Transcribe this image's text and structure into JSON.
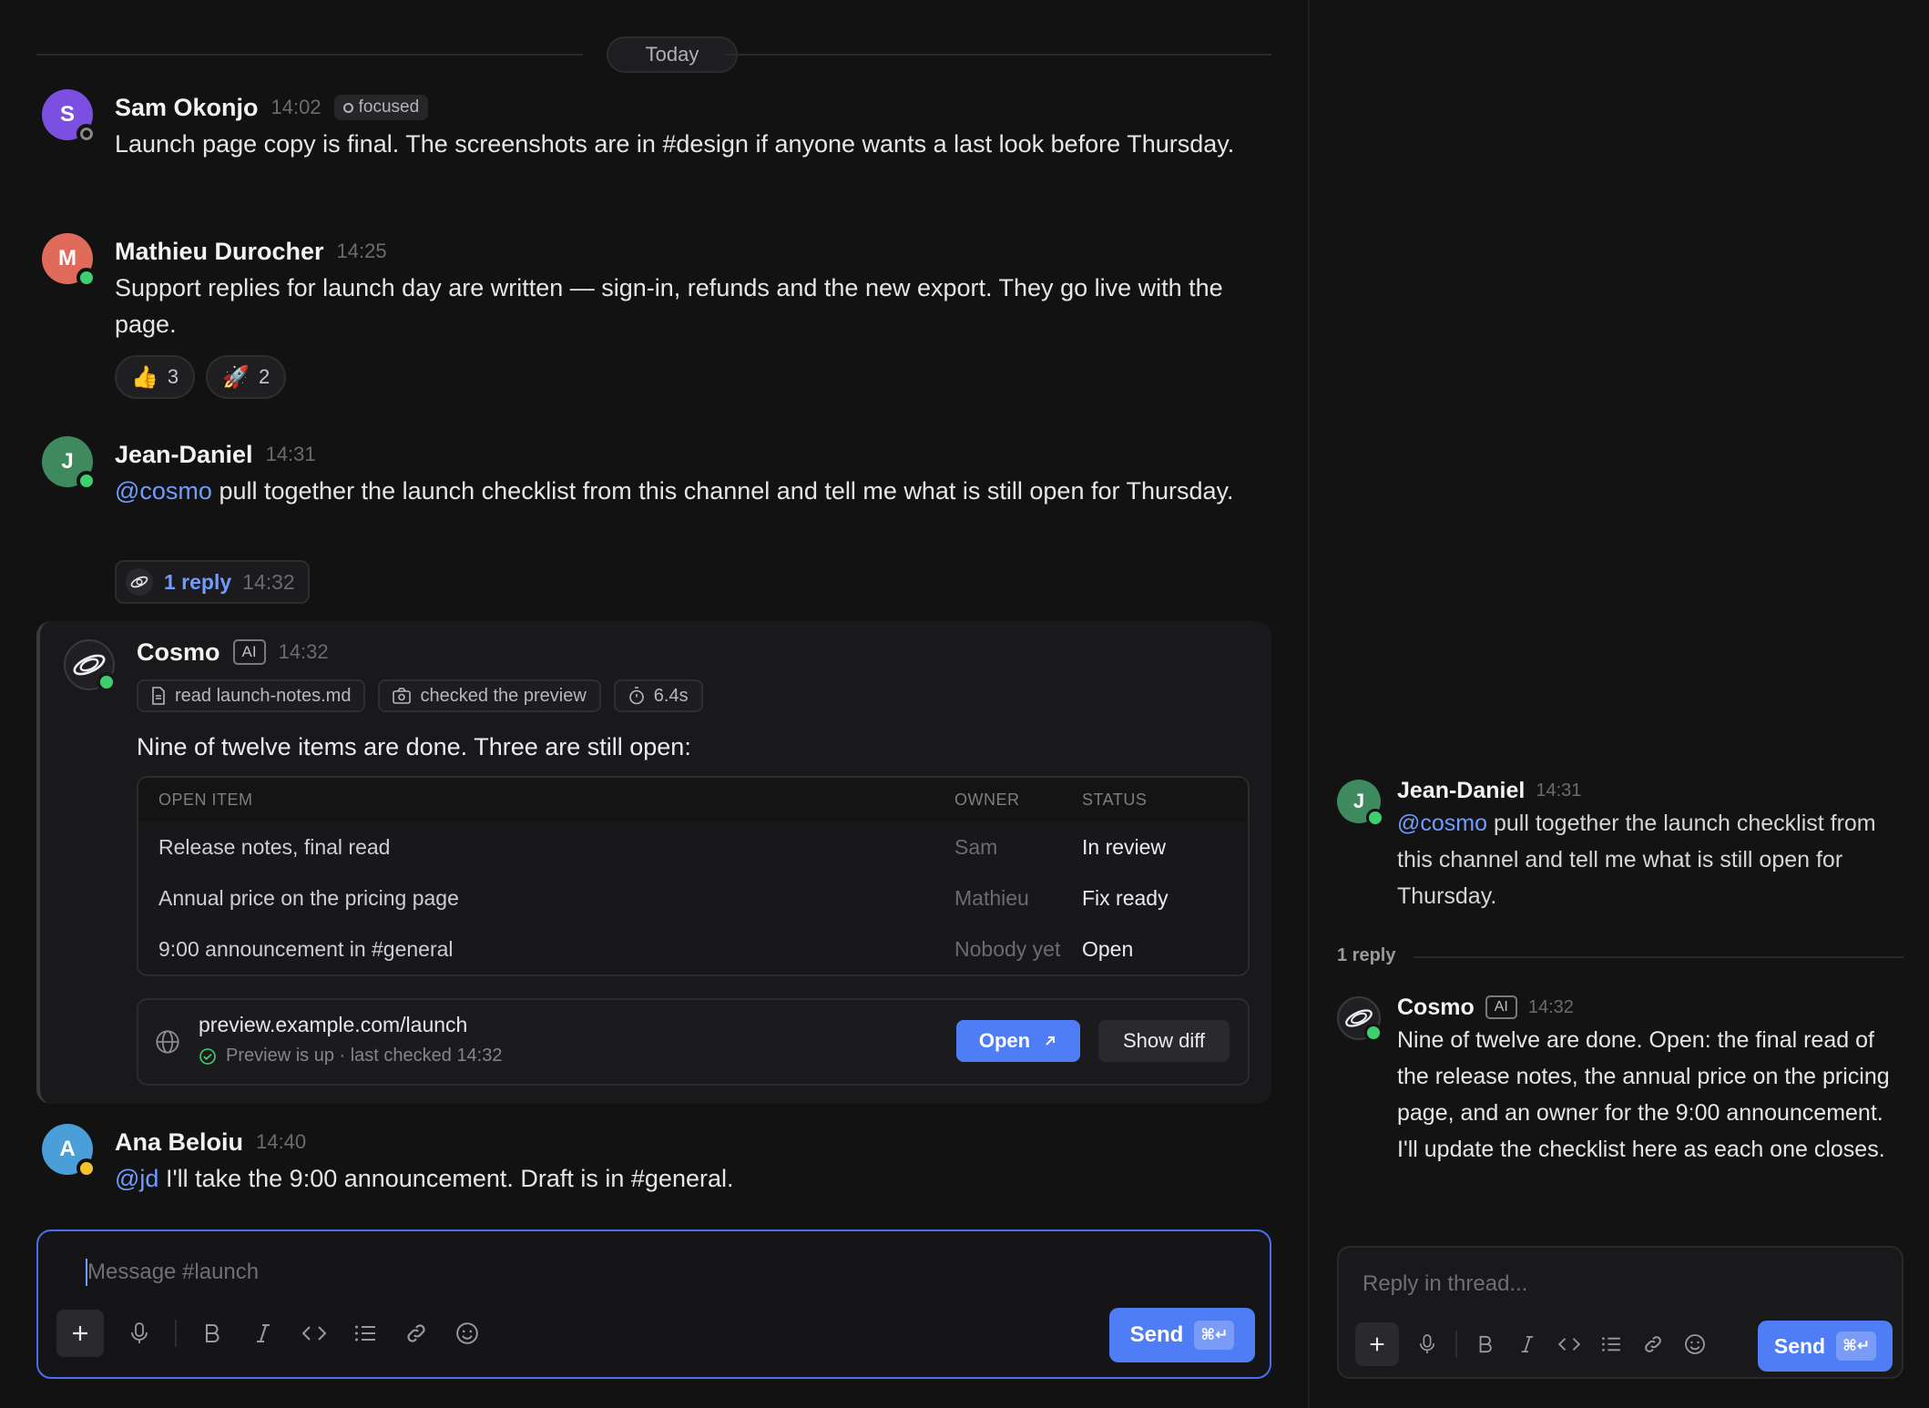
{
  "channel": {
    "date_divider": "Today",
    "messages": [
      {
        "initial": "S",
        "author": "Sam Okonjo",
        "time": "14:02",
        "status": "focused",
        "text": "Launch page copy is final. The screenshots are in #design if anyone wants a last look before Thursday.",
        "avatar_color": "#7b4fe0"
      },
      {
        "initial": "M",
        "author": "Mathieu Durocher",
        "time": "14:25",
        "text": "Support replies for launch day are written — sign-in, refunds and the new export. They go live with the page.",
        "avatar_color": "#e06b5a",
        "reactions": [
          {
            "emoji": "👍",
            "count": "3"
          },
          {
            "emoji": "🚀",
            "count": "2"
          }
        ]
      },
      {
        "initial": "J",
        "author": "Jean-Daniel",
        "time": "14:31",
        "mention": "@cosmo",
        "text": "pull together the launch checklist from this channel and tell me what is still open for Thursday.",
        "avatar_color": "#3e8a5e",
        "reply": {
          "count": "1 reply",
          "time": "14:32"
        }
      },
      {
        "initial": "A",
        "author": "Ana Beloiu",
        "time": "14:40",
        "mention": "@jd",
        "text": "I'll take the 9:00 announcement. Draft is in #general.",
        "avatar_color": "#4a9fd9"
      }
    ],
    "cosmo": {
      "author": "Cosmo",
      "badge": "AI",
      "time": "14:32",
      "tools": [
        "read launch-notes.md",
        "checked the preview",
        "6.4s"
      ],
      "summary": "Nine of twelve items are done. Three are still open:",
      "table": {
        "headers": [
          "OPEN ITEM",
          "OWNER",
          "STATUS"
        ],
        "rows": [
          [
            "Release notes, final read",
            "Sam",
            "In review"
          ],
          [
            "Annual price on the pricing page",
            "Mathieu",
            "Fix ready"
          ],
          [
            "9:00 announcement in #general",
            "Nobody yet",
            "Open"
          ]
        ]
      },
      "preview": {
        "url": "preview.example.com/launch",
        "status": "Preview is up · last checked 14:32",
        "open_label": "Open",
        "diff_label": "Show diff"
      }
    },
    "composer": {
      "placeholder": "Message #launch",
      "send_label": "Send",
      "shortcut": "⌘↵"
    }
  },
  "thread": {
    "parent": {
      "initial": "J",
      "author": "Jean-Daniel",
      "time": "14:31",
      "mention": "@cosmo",
      "text": "pull together the launch checklist from this channel and tell me what is still open for Thursday."
    },
    "reply_count": "1 reply",
    "reply": {
      "author": "Cosmo",
      "badge": "AI",
      "time": "14:32",
      "text": "Nine of twelve are done. Open: the final read of the release notes, the annual price on the pricing page, and an owner for the 9:00 announcement. I'll update the checklist here as each one closes."
    },
    "composer": {
      "placeholder": "Reply in thread...",
      "send_label": "Send",
      "shortcut": "⌘↵"
    }
  },
  "colors": {
    "accent": "#4f7df5",
    "mention": "#6f9cff",
    "online": "#3ecf6e",
    "away": "#f3c230"
  }
}
